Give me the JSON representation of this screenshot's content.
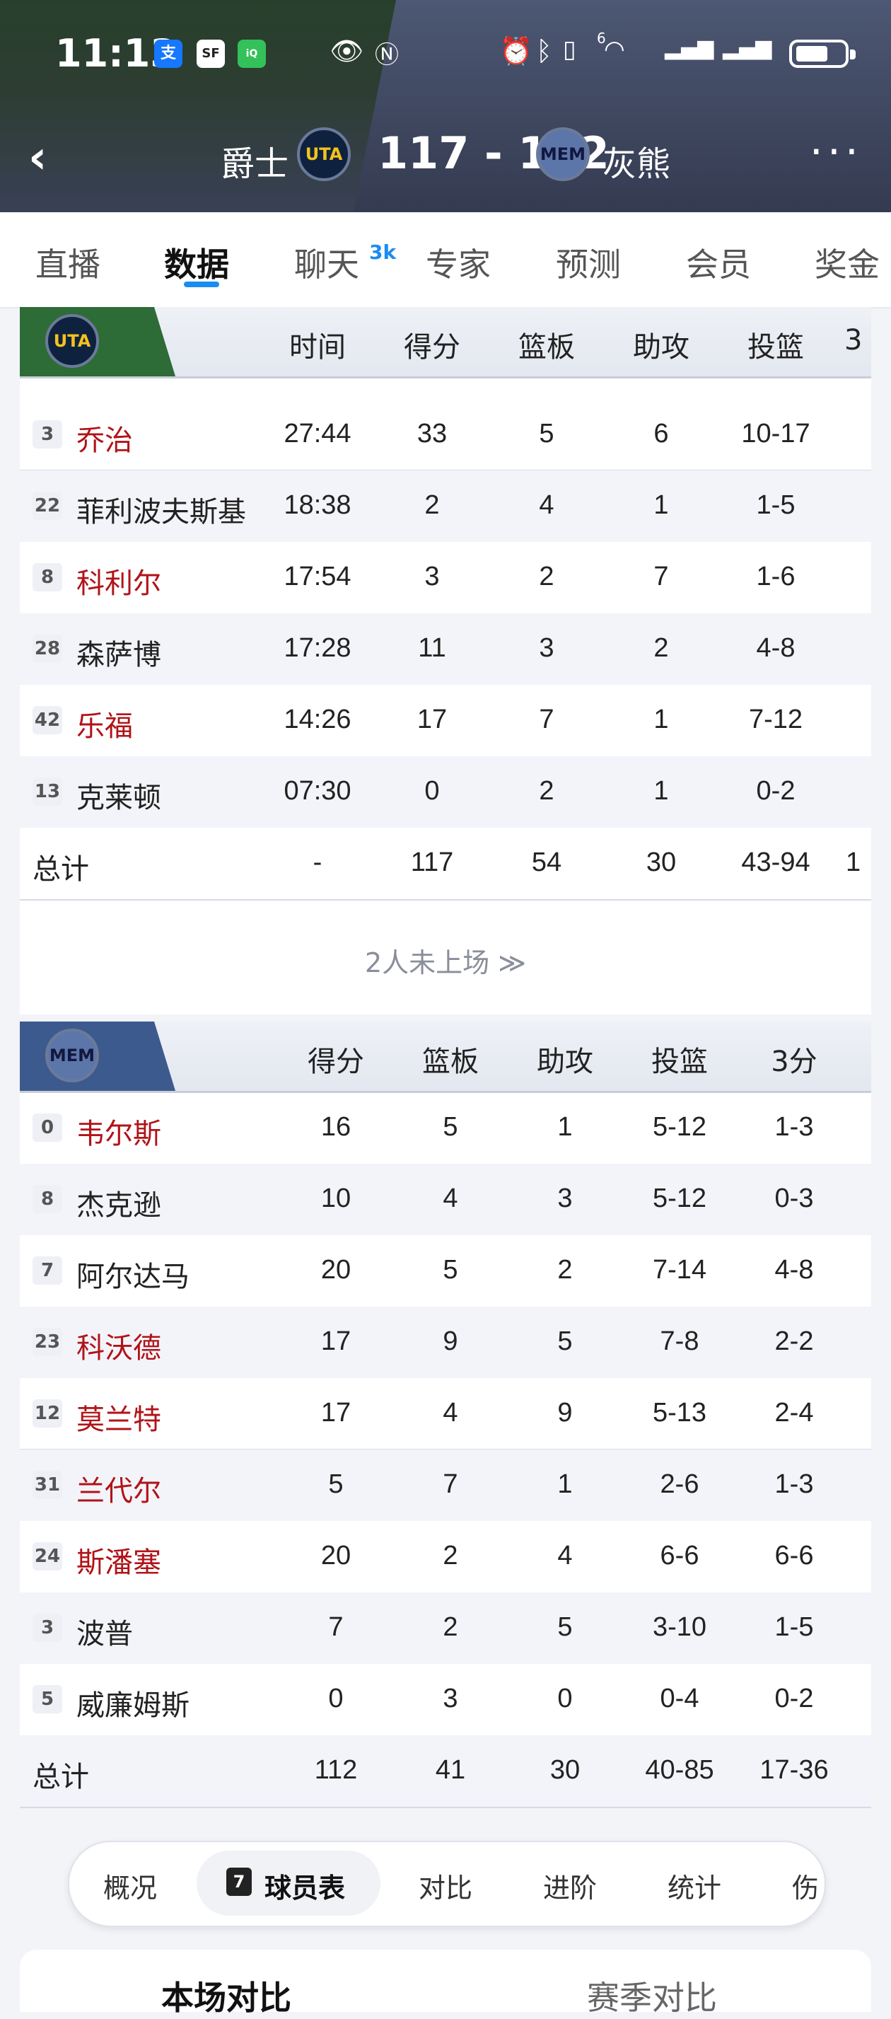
{
  "status_bar": {
    "time": "11:13",
    "icons": [
      "alipay-icon",
      "sf-icon",
      "iqiyi-icon",
      "eye-icon",
      "nfc-icon",
      "alarm-icon",
      "bluetooth-icon",
      "vibrate-icon",
      "wifi-icon",
      "signal-icon",
      "signal-icon",
      "battery-icon"
    ],
    "wifi_badge": "6"
  },
  "header": {
    "home_team": "爵士",
    "home_logo": "UTA",
    "score": "117 - 112",
    "away_logo": "MEM",
    "away_team": "灰熊"
  },
  "tabs": [
    {
      "label": "直播"
    },
    {
      "label": "数据"
    },
    {
      "label": "聊天"
    },
    {
      "label": "专家"
    },
    {
      "label": "预测"
    },
    {
      "label": "会员"
    },
    {
      "label": "奖金"
    }
  ],
  "chat_badge": "3k",
  "uta_table": {
    "logo": "UTA",
    "columns": [
      "时间",
      "得分",
      "篮板",
      "助攻",
      "投篮",
      "3"
    ],
    "rows": [
      {
        "num": "3",
        "name": "乔治",
        "starter": true,
        "cells": [
          "27:44",
          "33",
          "5",
          "6",
          "10-17"
        ]
      },
      {
        "num": "22",
        "name": "菲利波夫斯基",
        "starter": false,
        "cells": [
          "18:38",
          "2",
          "4",
          "1",
          "1-5"
        ]
      },
      {
        "num": "8",
        "name": "科利尔",
        "starter": true,
        "cells": [
          "17:54",
          "3",
          "2",
          "7",
          "1-6"
        ]
      },
      {
        "num": "28",
        "name": "森萨博",
        "starter": false,
        "cells": [
          "17:28",
          "11",
          "3",
          "2",
          "4-8"
        ]
      },
      {
        "num": "42",
        "name": "乐福",
        "starter": true,
        "cells": [
          "14:26",
          "17",
          "7",
          "1",
          "7-12"
        ]
      },
      {
        "num": "13",
        "name": "克莱顿",
        "starter": false,
        "cells": [
          "07:30",
          "0",
          "2",
          "1",
          "0-2"
        ]
      }
    ],
    "total": {
      "label": "总计",
      "cells": [
        "-",
        "117",
        "54",
        "30",
        "43-94",
        "1"
      ]
    },
    "dnp": "2人未上场 ≫"
  },
  "mem_table": {
    "logo": "MEM",
    "columns": [
      "得分",
      "篮板",
      "助攻",
      "投篮",
      "3分"
    ],
    "rows": [
      {
        "num": "0",
        "name": "韦尔斯",
        "starter": true,
        "cells": [
          "16",
          "5",
          "1",
          "5-12",
          "1-3"
        ]
      },
      {
        "num": "8",
        "name": "杰克逊",
        "starter": false,
        "cells": [
          "10",
          "4",
          "3",
          "5-12",
          "0-3"
        ]
      },
      {
        "num": "7",
        "name": "阿尔达马",
        "starter": false,
        "cells": [
          "20",
          "5",
          "2",
          "7-14",
          "4-8"
        ]
      },
      {
        "num": "23",
        "name": "科沃德",
        "starter": true,
        "cells": [
          "17",
          "9",
          "5",
          "7-8",
          "2-2"
        ]
      },
      {
        "num": "12",
        "name": "莫兰特",
        "starter": true,
        "cells": [
          "17",
          "4",
          "9",
          "5-13",
          "2-4"
        ]
      },
      {
        "num": "31",
        "name": "兰代尔",
        "starter": true,
        "cells": [
          "5",
          "7",
          "1",
          "2-6",
          "1-3"
        ]
      },
      {
        "num": "24",
        "name": "斯潘塞",
        "starter": true,
        "cells": [
          "20",
          "2",
          "4",
          "6-6",
          "6-6"
        ]
      },
      {
        "num": "3",
        "name": "波普",
        "starter": false,
        "cells": [
          "7",
          "2",
          "5",
          "3-10",
          "1-5"
        ]
      },
      {
        "num": "5",
        "name": "威廉姆斯",
        "starter": false,
        "cells": [
          "0",
          "3",
          "0",
          "0-4",
          "0-2"
        ]
      }
    ],
    "total": {
      "label": "总计",
      "cells": [
        "112",
        "41",
        "30",
        "40-85",
        "17-36"
      ]
    }
  },
  "subtabs": {
    "overview": "概况",
    "player_table": "球员表",
    "compare": "对比",
    "advanced": "进阶",
    "stats": "统计",
    "injury": "伤"
  },
  "compare_tabs": {
    "this_game": "本场对比",
    "season": "赛季对比"
  },
  "colors": {
    "starter_name": "#b01318",
    "accent_blue": "#1b8cf0",
    "uta_green": "#2d6b37",
    "mem_blue": "#3c5a8e"
  }
}
